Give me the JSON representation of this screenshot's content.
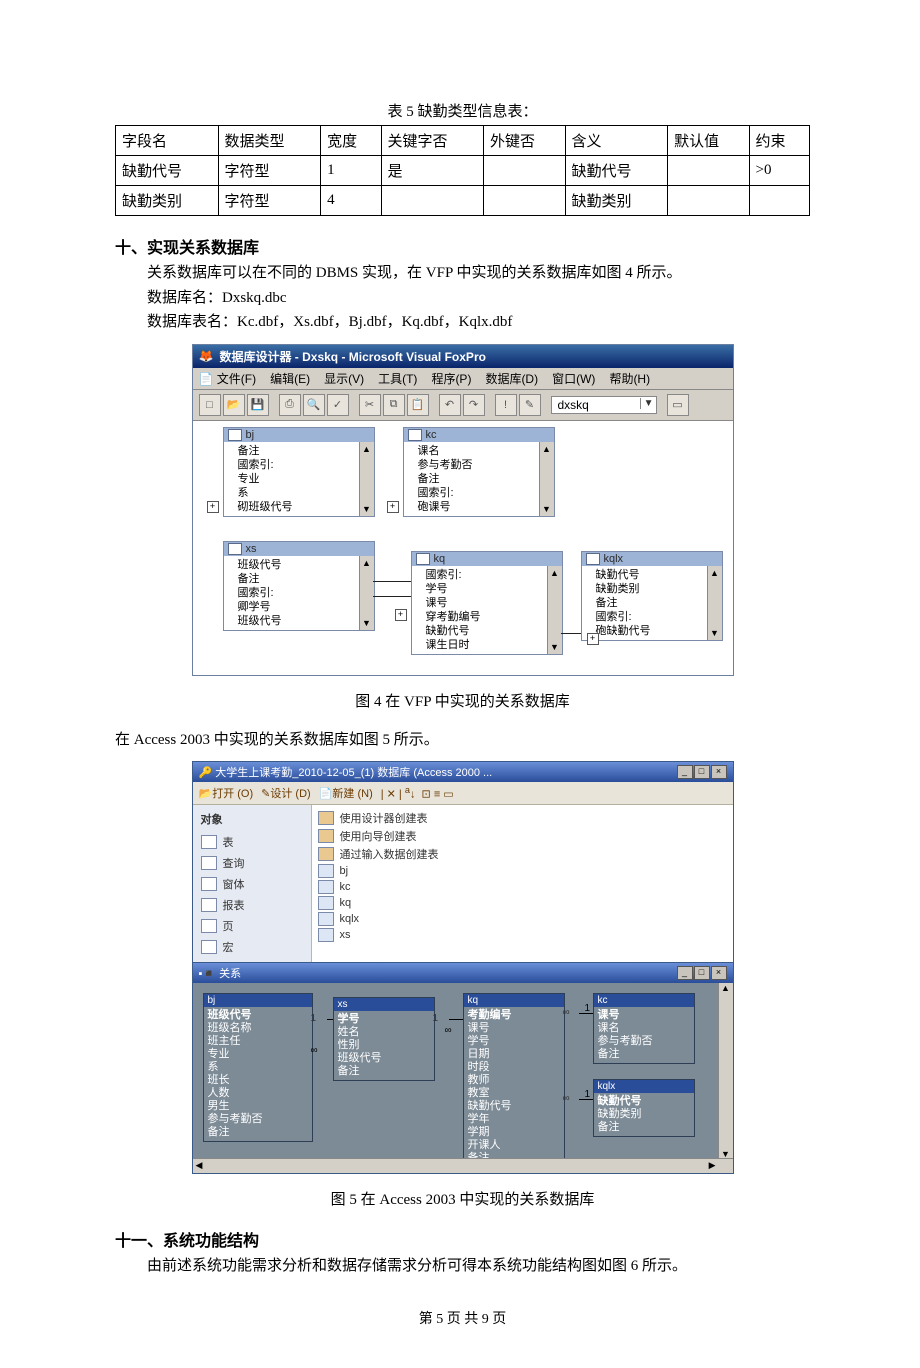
{
  "table5": {
    "caption": "表 5   缺勤类型信息表：",
    "headers": [
      "字段名",
      "数据类型",
      "宽度",
      "关键字否",
      "外键否",
      "含义",
      "默认值",
      "约束"
    ],
    "rows": [
      [
        "缺勤代号",
        "字符型",
        "1",
        "是",
        "",
        "缺勤代号",
        "",
        ">0"
      ],
      [
        "缺勤类别",
        "字符型",
        "4",
        "",
        "",
        "缺勤类别",
        "",
        ""
      ]
    ]
  },
  "sec10": {
    "title": "十、实现关系数据库",
    "p1": "关系数据库可以在不同的 DBMS 实现，在 VFP 中实现的关系数据库如图 4 所示。",
    "p2": "数据库名：Dxskq.dbc",
    "p3": "数据库表名：Kc.dbf，Xs.dbf，Bj.dbf，Kq.dbf，Kqlx.dbf"
  },
  "fig4": {
    "title_bar": "数据库设计器 - Dxskq - Microsoft Visual FoxPro",
    "menu": [
      "文件(F)",
      "编辑(E)",
      "显示(V)",
      "工具(T)",
      "程序(P)",
      "数据库(D)",
      "窗口(W)",
      "帮助(H)"
    ],
    "combo": "dxskq",
    "boxes": {
      "bj": {
        "title": "bj",
        "rows": [
          "备注",
          "國索引:",
          "专业",
          "系",
          "砌班级代号"
        ]
      },
      "kc": {
        "title": "kc",
        "rows": [
          "课名",
          "参与考勤否",
          "备注",
          "國索引:",
          "砲课号"
        ]
      },
      "xs": {
        "title": "xs",
        "rows": [
          "班级代号",
          "备注",
          "國索引:",
          "卿学号",
          "班级代号"
        ]
      },
      "kq": {
        "title": "kq",
        "rows": [
          "國索引:",
          "学号",
          "课号",
          "穿考勤编号",
          "缺勤代号",
          "课生日时"
        ]
      },
      "kqlx": {
        "title": "kqlx",
        "rows": [
          "缺勤代号",
          "缺勤类别",
          "备注",
          "國索引:",
          "砲缺勤代号"
        ]
      }
    },
    "caption": "图 4    在 VFP 中实现的关系数据库"
  },
  "between_text": "在 Access 2003 中实现的关系数据库如图 5 所示。",
  "fig5": {
    "title_bar": "大学生上课考勤_2010-12-05_(1)   数据库  (Access 2000 ...",
    "toolbar": [
      "打开 (O)",
      "设计 (D)",
      "新建 (N)"
    ],
    "nav_header": "对象",
    "nav": [
      "表",
      "查询",
      "窗体",
      "报表",
      "页",
      "宏"
    ],
    "list": [
      {
        "icon": "k",
        "label": "使用设计器创建表"
      },
      {
        "icon": "k",
        "label": "使用向导创建表"
      },
      {
        "icon": "k",
        "label": "通过输入数据创建表"
      },
      {
        "icon": "t",
        "label": "bj"
      },
      {
        "icon": "t",
        "label": "kc"
      },
      {
        "icon": "t",
        "label": "kq"
      },
      {
        "icon": "t",
        "label": "kqlx"
      },
      {
        "icon": "t",
        "label": "xs"
      }
    ],
    "rel_title": "关系",
    "rel": {
      "bj": {
        "title": "bj",
        "rows": [
          "班级代号",
          "班级名称",
          "班主任",
          "专业",
          "系",
          "班长",
          "人数",
          "男生",
          "参与考勤否",
          "备注"
        ],
        "bold": 0
      },
      "xs": {
        "title": "xs",
        "rows": [
          "学号",
          "姓名",
          "性别",
          "班级代号",
          "备注"
        ],
        "bold": 0
      },
      "kq": {
        "title": "kq",
        "rows": [
          "考勤编号",
          "课号",
          "学号",
          "日期",
          "时段",
          "教师",
          "教室",
          "缺勤代号",
          "学年",
          "学期",
          "开课人",
          "备注"
        ],
        "bold": 0
      },
      "kc": {
        "title": "kc",
        "rows": [
          "课号",
          "课名",
          "参与考勤否",
          "备注"
        ],
        "bold": 0
      },
      "kqlx": {
        "title": "kqlx",
        "rows": [
          "缺勤代号",
          "缺勤类别",
          "备注"
        ],
        "bold": 0
      }
    },
    "caption": "图 5    在 Access 2003 中实现的关系数据库"
  },
  "sec11": {
    "title": "十一、系统功能结构",
    "p1": "由前述系统功能需求分析和数据存储需求分析可得本系统功能结构图如图 6 所示。"
  },
  "footer": "第  5  页  共  9  页"
}
